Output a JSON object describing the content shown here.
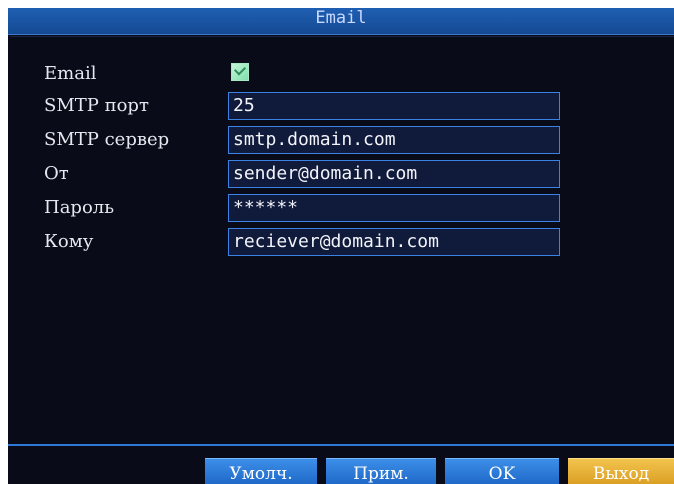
{
  "window": {
    "title": "Email"
  },
  "form": {
    "email_label": "Email",
    "email_enabled": true,
    "smtp_port_label": "SMTP порт",
    "smtp_port_value": "25",
    "smtp_server_label": "SMTP сервер",
    "smtp_server_value": "smtp.domain.com",
    "from_label": "От",
    "from_value": "sender@domain.com",
    "password_label": "Пароль",
    "password_value": "******",
    "to_label": "Кому",
    "to_value": "reciever@domain.com"
  },
  "buttons": {
    "default_label": "Умолч.",
    "apply_label": "Прим.",
    "ok_label": "OK",
    "exit_label": "Выход"
  },
  "colors": {
    "background": "#090b18",
    "accent": "#3c82e6",
    "exit_button": "#e8b43a"
  }
}
